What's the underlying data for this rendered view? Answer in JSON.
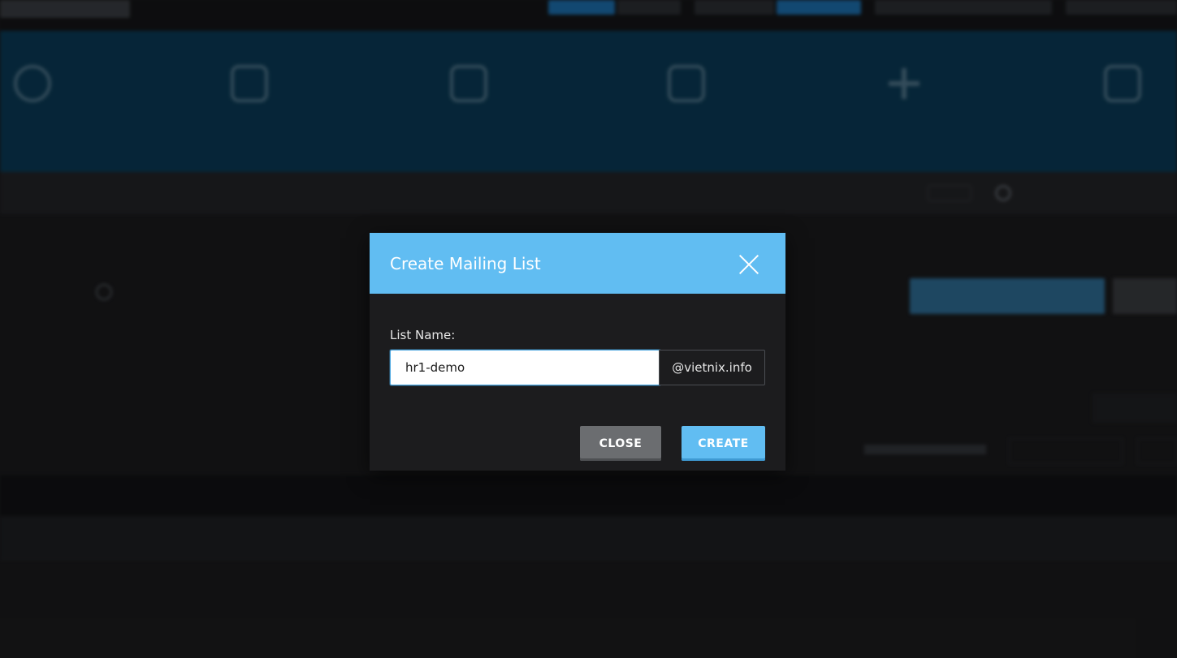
{
  "modal": {
    "title": "Create Mailing List",
    "field_label": "List Name:",
    "list_name_value": "hr1-demo",
    "domain_suffix": "@vietnix.info",
    "close_label": "CLOSE",
    "create_label": "CREATE"
  },
  "colors": {
    "accent": "#61bdf2",
    "header_band": "#0a3a56",
    "close_button": "#6b6d70"
  }
}
